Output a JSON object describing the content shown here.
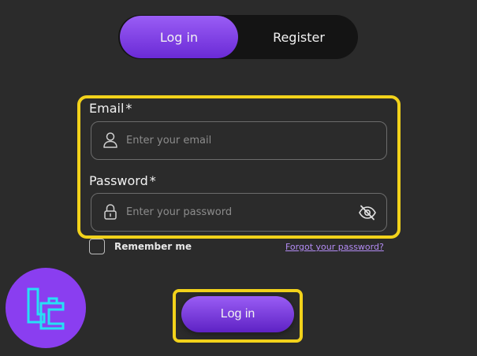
{
  "tabs": {
    "login_label": "Log in",
    "register_label": "Register",
    "active": "login"
  },
  "form": {
    "email": {
      "label": "Email",
      "required_mark": "*",
      "placeholder": "Enter your email",
      "value": "",
      "icon": "user-icon"
    },
    "password": {
      "label": "Password",
      "required_mark": "*",
      "placeholder": "Enter your password",
      "value": "",
      "icon": "lock-icon",
      "toggle_icon": "eye-slash-icon"
    },
    "remember_label": "Remember me",
    "remember_checked": false,
    "forgot_label": "Forgot your password?",
    "submit_label": "Log in"
  },
  "logo": {
    "icon": "brand-logo-icon"
  },
  "colors": {
    "background": "#2b2b2b",
    "accent": "#8a3ef0",
    "accent_light": "#9a5df5",
    "highlight": "#f2d21b",
    "link": "#b48cf5",
    "logo_stroke": "#27e0f5"
  }
}
